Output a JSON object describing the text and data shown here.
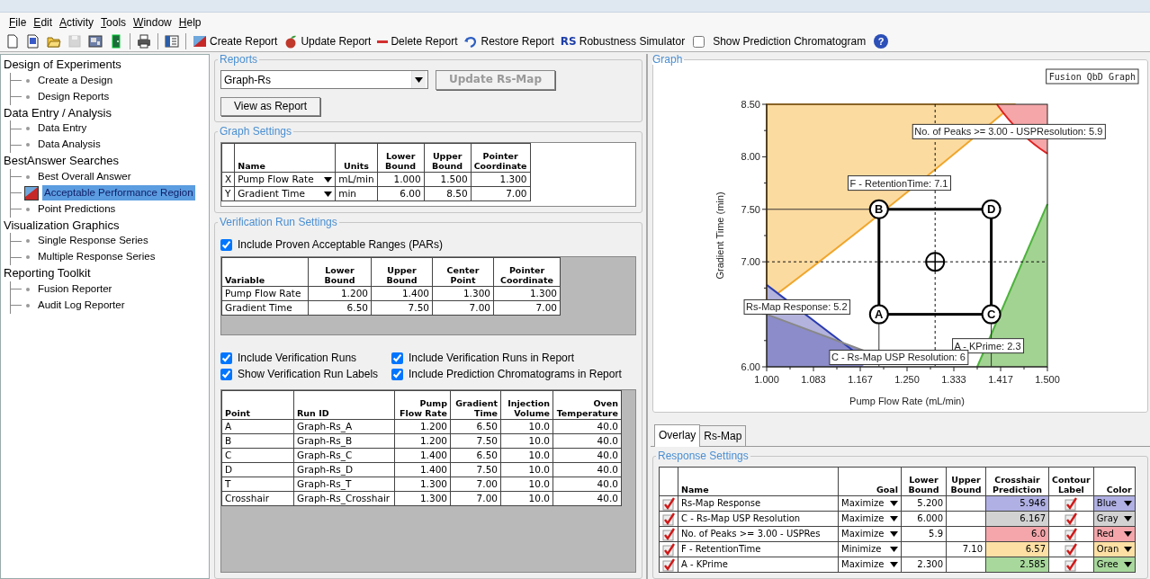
{
  "menu": [
    "File",
    "Edit",
    "Activity",
    "Tools",
    "Window",
    "Help"
  ],
  "toolbar": {
    "icon_buttons": [
      {
        "disabled": false
      },
      {
        "disabled": false
      },
      {
        "disabled": false
      },
      {
        "disabled": true
      },
      {
        "disabled": false
      },
      {
        "disabled": false
      },
      {
        "disabled": false
      },
      {
        "disabled": false
      }
    ],
    "buttons": [
      {
        "label": "Create Report"
      },
      {
        "label": "Update Report"
      },
      {
        "label": "Delete Report"
      },
      {
        "label": "Restore Report"
      },
      {
        "label": "Robustness Simulator",
        "icon_text": "RS"
      }
    ],
    "show_prediction": {
      "label": "Show Prediction Chromatogram",
      "checked": false
    },
    "help_glyph": "?"
  },
  "tree": [
    {
      "label": "Design of Experiments",
      "selected": false,
      "children": [
        {
          "label": "Create a Design",
          "selected": false
        },
        {
          "label": "Design Reports",
          "selected": false
        }
      ]
    },
    {
      "label": "Data Entry / Analysis",
      "selected": false,
      "children": [
        {
          "label": "Data Entry",
          "selected": false
        },
        {
          "label": "Data Analysis",
          "selected": false
        }
      ]
    },
    {
      "label": "BestAnswer Searches",
      "selected": false,
      "children": [
        {
          "label": "Best Overall Answer",
          "selected": false
        },
        {
          "label": "Acceptable Performance Region",
          "selected": true
        },
        {
          "label": "Point Predictions",
          "selected": false
        }
      ]
    },
    {
      "label": "Visualization Graphics",
      "selected": false,
      "children": [
        {
          "label": "Single Response Series",
          "selected": false
        },
        {
          "label": "Multiple Response Series",
          "selected": false
        }
      ]
    },
    {
      "label": "Reporting Toolkit",
      "selected": false,
      "children": [
        {
          "label": "Fusion Reporter",
          "selected": false
        },
        {
          "label": "Audit Log Reporter",
          "selected": false
        }
      ]
    }
  ],
  "reports": {
    "title": "Reports",
    "report_select": {
      "value": "Graph-Rs"
    },
    "update_button": {
      "label": "Update Rs-Map",
      "disabled": true
    },
    "view_button": {
      "label": "View as Report"
    }
  },
  "graph_settings": {
    "title": "Graph Settings",
    "columns": [
      "Name",
      "Units",
      "Lower Bound",
      "Upper Bound",
      "Pointer Coordinate"
    ],
    "rows": [
      {
        "axis": "X",
        "name": "Pump Flow Rate",
        "units": "mL/min",
        "lower": "1.000",
        "upper": "1.500",
        "pointer": "1.300"
      },
      {
        "axis": "Y",
        "name": "Gradient Time",
        "units": "min",
        "lower": "6.00",
        "upper": "8.50",
        "pointer": "7.00"
      }
    ]
  },
  "verification": {
    "title": "Verification Run Settings",
    "include_pars": {
      "label": "Include Proven Acceptable Ranges (PARs)",
      "checked": true
    },
    "par_table": {
      "columns": [
        "Variable",
        "Lower Bound",
        "Upper Bound",
        "Center Point",
        "Pointer Coordinate"
      ],
      "rows": [
        {
          "cells": [
            "Pump Flow Rate",
            "1.200",
            "1.400",
            "1.300",
            "1.300"
          ]
        },
        {
          "cells": [
            "Gradient Time",
            "6.50",
            "7.50",
            "7.00",
            "7.00"
          ]
        }
      ]
    },
    "options": [
      {
        "label": "Include Verification Runs",
        "checked": true
      },
      {
        "label": "Include Verification Runs in Report",
        "checked": true
      },
      {
        "label": "Show Verification Run Labels",
        "checked": true
      },
      {
        "label": "Include Prediction Chromatograms in Report",
        "checked": true
      }
    ],
    "runs_table": {
      "columns": [
        "Point",
        "Run ID",
        "Pump Flow Rate",
        "Gradient Time",
        "Injection Volume",
        "Oven Temperature"
      ],
      "rows": [
        {
          "cells": [
            "A",
            "Graph-Rs_A",
            "1.200",
            "6.50",
            "10.0",
            "40.0"
          ]
        },
        {
          "cells": [
            "B",
            "Graph-Rs_B",
            "1.200",
            "7.50",
            "10.0",
            "40.0"
          ]
        },
        {
          "cells": [
            "C",
            "Graph-Rs_C",
            "1.400",
            "6.50",
            "10.0",
            "40.0"
          ]
        },
        {
          "cells": [
            "D",
            "Graph-Rs_D",
            "1.400",
            "7.50",
            "10.0",
            "40.0"
          ]
        },
        {
          "cells": [
            "T",
            "Graph-Rs_T",
            "1.300",
            "7.00",
            "10.0",
            "40.0"
          ]
        },
        {
          "cells": [
            "Crosshair",
            "Graph-Rs_Crosshair",
            "1.300",
            "7.00",
            "10.0",
            "40.0"
          ]
        }
      ]
    }
  },
  "graph": {
    "title": "Graph",
    "chart_data": {
      "type": "scatter",
      "title": "Fusion QbD Graph",
      "xlabel": "Pump Flow Rate (mL/min)",
      "ylabel": "Gradient Time (min)",
      "x": [
        1.2,
        1.2,
        1.4,
        1.4,
        1.3
      ],
      "series": [
        {
          "name": "A",
          "color": "#000000",
          "values": [
            6.5,
            null,
            null,
            null,
            null
          ]
        },
        {
          "name": "B",
          "color": "#000000",
          "values": [
            null,
            7.5,
            null,
            null,
            null
          ]
        },
        {
          "name": "C",
          "color": "#000000",
          "values": [
            null,
            null,
            6.5,
            null,
            null
          ]
        },
        {
          "name": "D",
          "color": "#000000",
          "values": [
            null,
            null,
            null,
            7.5,
            null
          ]
        },
        {
          "color": "#000000",
          "values": [
            null,
            null,
            null,
            null,
            7.0
          ]
        }
      ],
      "xlim": [
        1.0,
        1.5
      ],
      "ylim": [
        6.0,
        8.5
      ],
      "xticks": [
        {
          "value": 1.0,
          "label": "1.000"
        },
        {
          "value": 1.0833,
          "label": "1.083"
        },
        {
          "value": 1.1667,
          "label": "1.167"
        },
        {
          "value": 1.25,
          "label": "1.250"
        },
        {
          "value": 1.3333,
          "label": "1.333"
        },
        {
          "value": 1.4167,
          "label": "1.417"
        },
        {
          "value": 1.5,
          "label": "1.500"
        }
      ],
      "yticks": [
        {
          "value": 6.0,
          "label": "6.00"
        },
        {
          "value": 7.0,
          "label": "7.00"
        },
        {
          "value": 7.5,
          "label": "7.50"
        },
        {
          "value": 8.0,
          "label": "8.00"
        },
        {
          "value": 8.5,
          "label": "8.50"
        }
      ],
      "annotations": [
        "No. of Peaks >= 3.00 - USPResolution: 5.9",
        "F - RetentionTime: 7.1",
        "Rs-Map Response: 5.2",
        "A - KPrime: 2.3",
        "C - Rs-Map USP Resolution: 6"
      ]
    }
  },
  "tabs": [
    {
      "label": "Overlay",
      "selected": true
    },
    {
      "label": "Rs-Map",
      "selected": false
    }
  ],
  "response_settings": {
    "title": "Response Settings",
    "columns": [
      "Name",
      "Goal",
      "Lower Bound",
      "Upper Bound",
      "Crosshair Prediction",
      "Contour Label",
      "Color"
    ],
    "rows": [
      {
        "enabled": true,
        "name": "Rs-Map Response",
        "goal": "Maximize",
        "lower": "5.200",
        "prediction": "5.946",
        "contour_label": true,
        "color_name": "Blue",
        "color": "#b0b0e4"
      },
      {
        "enabled": true,
        "name": "C - Rs-Map USP Resolution",
        "goal": "Maximize",
        "lower": "6.000",
        "prediction": "6.167",
        "contour_label": true,
        "color_name": "Gray",
        "color": "#d2d2d2"
      },
      {
        "enabled": true,
        "name": "No. of Peaks >= 3.00 - USPRes",
        "goal": "Maximize",
        "lower": "5.9",
        "prediction": "6.0",
        "contour_label": true,
        "color_name": "Red",
        "color": "#f4a6aa"
      },
      {
        "enabled": true,
        "name": "F - RetentionTime",
        "goal": "Minimize",
        "upper": "7.10",
        "prediction": "6.57",
        "contour_label": true,
        "color_name": "Oran",
        "color": "#fde0a4"
      },
      {
        "enabled": true,
        "name": "A - KPrime",
        "goal": "Maximize",
        "lower": "2.300",
        "prediction": "2.585",
        "contour_label": true,
        "color_name": "Gree",
        "color": "#a8d89c"
      }
    ]
  }
}
